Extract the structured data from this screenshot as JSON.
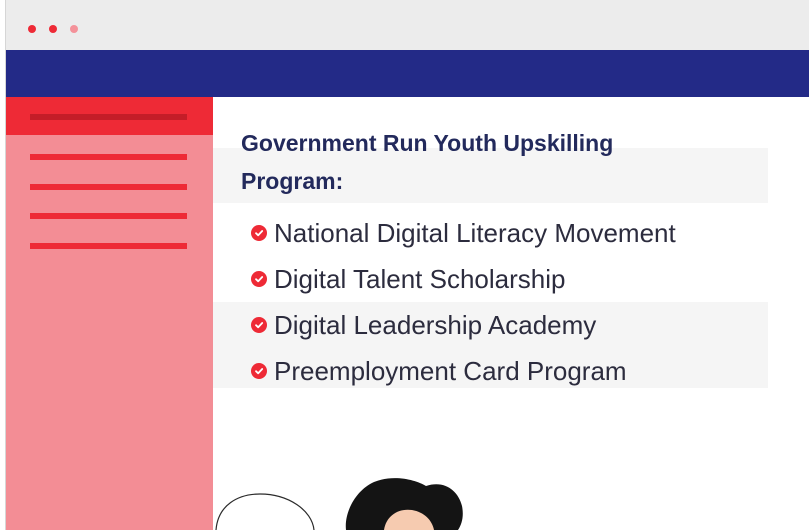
{
  "window": {
    "controls": [
      "close-dot",
      "minimize-dot",
      "maximize-dot"
    ]
  },
  "main": {
    "heading": "Government Run Youth Upskilling Program:",
    "items": [
      {
        "label": "National Digital Literacy Movement"
      },
      {
        "label": "Digital Talent Scholarship"
      },
      {
        "label": "Digital Leadership Academy"
      },
      {
        "label": "Preemployment Card Program"
      }
    ]
  },
  "sidebar": {
    "lines": 5,
    "active_index": 0
  },
  "colors": {
    "navbar": "#232a87",
    "accent": "#ee2a36",
    "sidebar": "#f38d95",
    "heading": "#232a5c",
    "text": "#2c2c3e"
  },
  "icons": {
    "list_bullet": "check-circle-icon"
  }
}
